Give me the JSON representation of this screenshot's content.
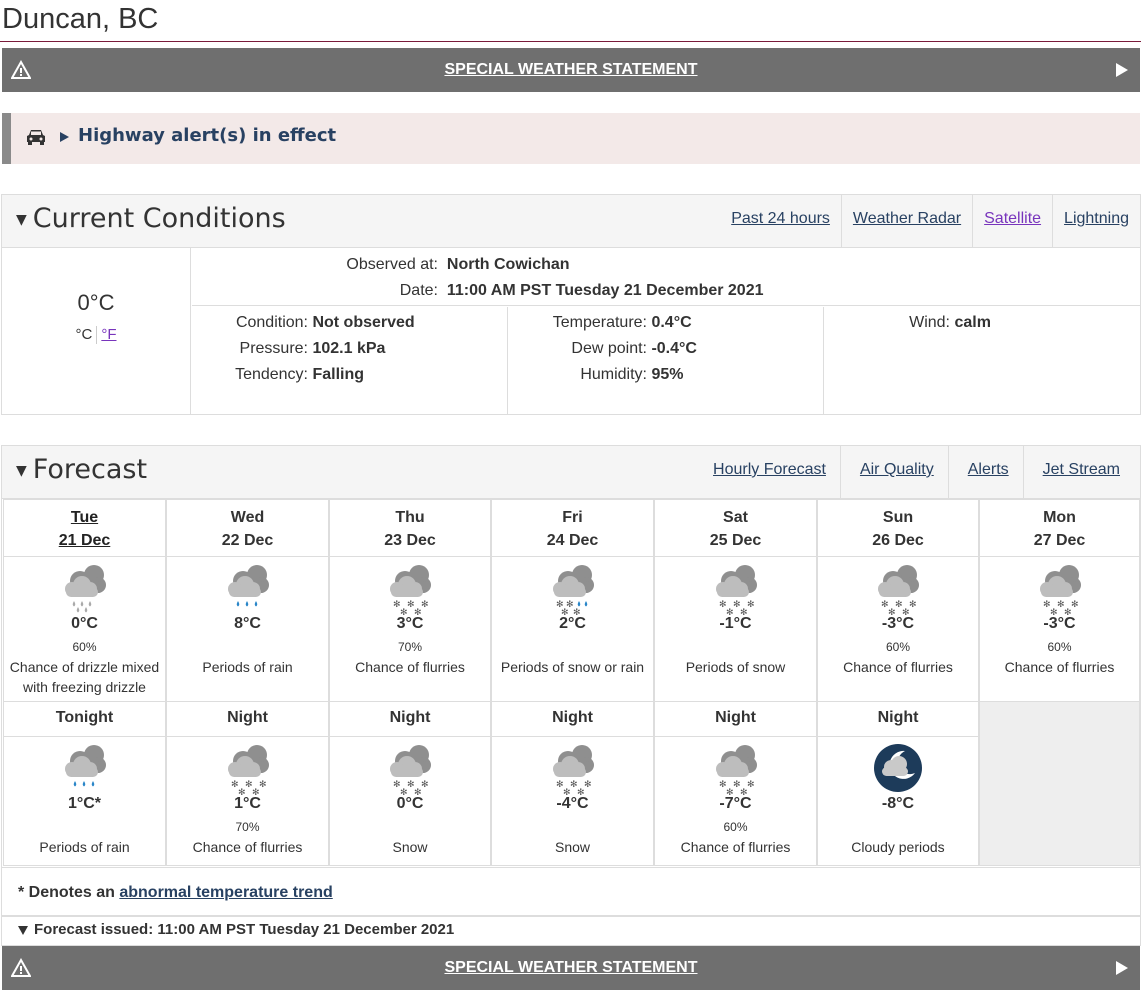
{
  "page": {
    "title": "Duncan, BC"
  },
  "alert": {
    "label": "SPECIAL WEATHER STATEMENT"
  },
  "highway": {
    "label": "Highway alert(s) in effect"
  },
  "current": {
    "heading": "Current Conditions",
    "links": [
      "Past 24 hours",
      "Weather Radar",
      "Satellite",
      "Lightning"
    ],
    "temp": "0°C",
    "unit_c": "°C",
    "unit_f": "°F",
    "observed_label": "Observed at:",
    "observed_value": "North Cowichan",
    "date_label": "Date:",
    "date_value": "11:00 AM PST Tuesday 21 December 2021",
    "condition_label": "Condition:",
    "condition_value": "Not observed",
    "pressure_label": "Pressure:",
    "pressure_value": "102.1 kPa",
    "tendency_label": "Tendency:",
    "tendency_value": "Falling",
    "temperature_label": "Temperature:",
    "temperature_value": "0.4°C",
    "dewpoint_label": "Dew point:",
    "dewpoint_value": "-0.4°C",
    "humidity_label": "Humidity:",
    "humidity_value": "95%",
    "wind_label": "Wind:",
    "wind_value": "calm"
  },
  "forecast": {
    "heading": "Forecast",
    "links": [
      "Hourly Forecast",
      "Air Quality",
      "Alerts",
      "Jet Stream"
    ],
    "days": [
      {
        "day": "Tue",
        "date": "21 Dec",
        "temp": "0°C",
        "pop": "60%",
        "summary": "Chance of drizzle mixed with freezing drizzle",
        "icon": "drizzle-freezing-icon"
      },
      {
        "day": "Wed",
        "date": "22 Dec",
        "temp": "8°C",
        "pop": "",
        "summary": "Periods of rain",
        "icon": "rain-icon"
      },
      {
        "day": "Thu",
        "date": "23 Dec",
        "temp": "3°C",
        "pop": "70%",
        "summary": "Chance of flurries",
        "icon": "snow-icon"
      },
      {
        "day": "Fri",
        "date": "24 Dec",
        "temp": "2°C",
        "pop": "",
        "summary": "Periods of snow or rain",
        "icon": "snow-rain-icon"
      },
      {
        "day": "Sat",
        "date": "25 Dec",
        "temp": "-1°C",
        "pop": "",
        "summary": "Periods of snow",
        "icon": "snow-icon"
      },
      {
        "day": "Sun",
        "date": "26 Dec",
        "temp": "-3°C",
        "pop": "60%",
        "summary": "Chance of flurries",
        "icon": "snow-icon"
      },
      {
        "day": "Mon",
        "date": "27 Dec",
        "temp": "-3°C",
        "pop": "60%",
        "summary": "Chance of flurries",
        "icon": "snow-icon"
      }
    ],
    "nights": [
      {
        "label": "Tonight",
        "temp": "1°C*",
        "pop": "",
        "summary": "Periods of rain",
        "icon": "rain-icon"
      },
      {
        "label": "Night",
        "temp": "1°C",
        "pop": "70%",
        "summary": "Chance of flurries",
        "icon": "snow-icon"
      },
      {
        "label": "Night",
        "temp": "0°C",
        "pop": "",
        "summary": "Snow",
        "icon": "snow-icon"
      },
      {
        "label": "Night",
        "temp": "-4°C",
        "pop": "",
        "summary": "Snow",
        "icon": "snow-icon"
      },
      {
        "label": "Night",
        "temp": "-7°C",
        "pop": "60%",
        "summary": "Chance of flurries",
        "icon": "snow-icon"
      },
      {
        "label": "Night",
        "temp": "-8°C",
        "pop": "",
        "summary": "Cloudy periods",
        "icon": "cloudy-night-icon"
      }
    ],
    "note_prefix": "* Denotes an ",
    "note_link": "abnormal temperature trend",
    "issued": "Forecast issued: 11:00 AM PST Tuesday 21 December 2021"
  },
  "colors": {
    "link": "#284162",
    "alert_bar": "#6f6f6f",
    "highway_bg": "#f3e9e8"
  }
}
